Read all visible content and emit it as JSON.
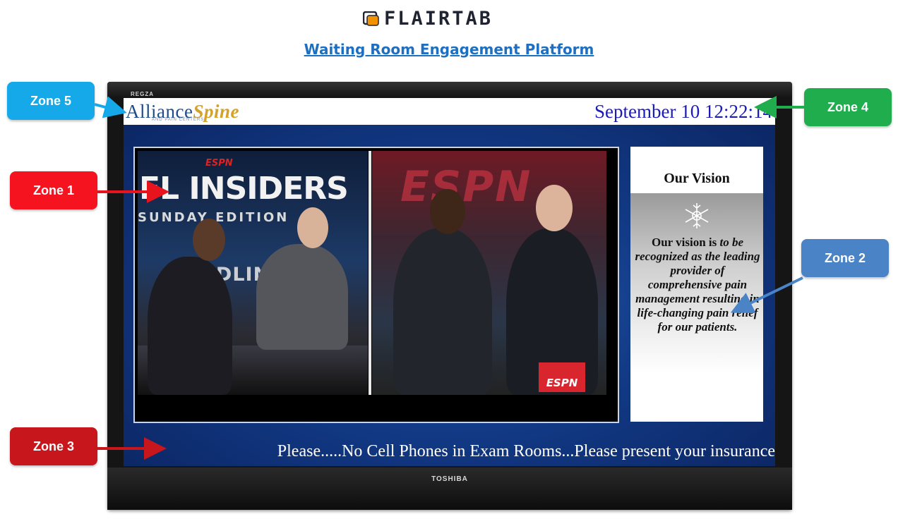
{
  "header": {
    "logo_text": "FLAIRTAB",
    "subtitle": "Waiting Room Engagement Platform"
  },
  "tv": {
    "brand_top": "REGZA",
    "brand_bottom": "TOSHIBA"
  },
  "screen": {
    "brand_name_1": "Alliance",
    "brand_name_2": "Spine",
    "brand_tagline": "AND PAIN CENTERS",
    "clock": "September 10 12:22:14",
    "video": {
      "espn_small": "ESPN",
      "show_title": "FL INSIDERS",
      "show_subtitle": "SUNDAY EDITION",
      "segment": "HEADLINES",
      "espn_right": "ESPN",
      "espn_badge": "ESPN"
    },
    "vision": {
      "title": "Our Vision",
      "text_lead": "Our vision is ",
      "text_italic": "to be recognized as the leading provider of comprehensive pain management resulting in life-changing pain relief for our patients."
    },
    "ticker": "Please.....No Cell Phones in Exam Rooms...Please present your insurance"
  },
  "zones": {
    "zone1": "Zone 1",
    "zone2": "Zone 2",
    "zone3": "Zone 3",
    "zone4": "Zone 4",
    "zone5": "Zone 5"
  },
  "colors": {
    "zone1": "#f5131f",
    "zone2": "#4a83c6",
    "zone3": "#c8161d",
    "zone4": "#1fad4e",
    "zone5": "#15a9ea",
    "subtitle": "#1f6fc0",
    "clock": "#1b1bb8"
  }
}
